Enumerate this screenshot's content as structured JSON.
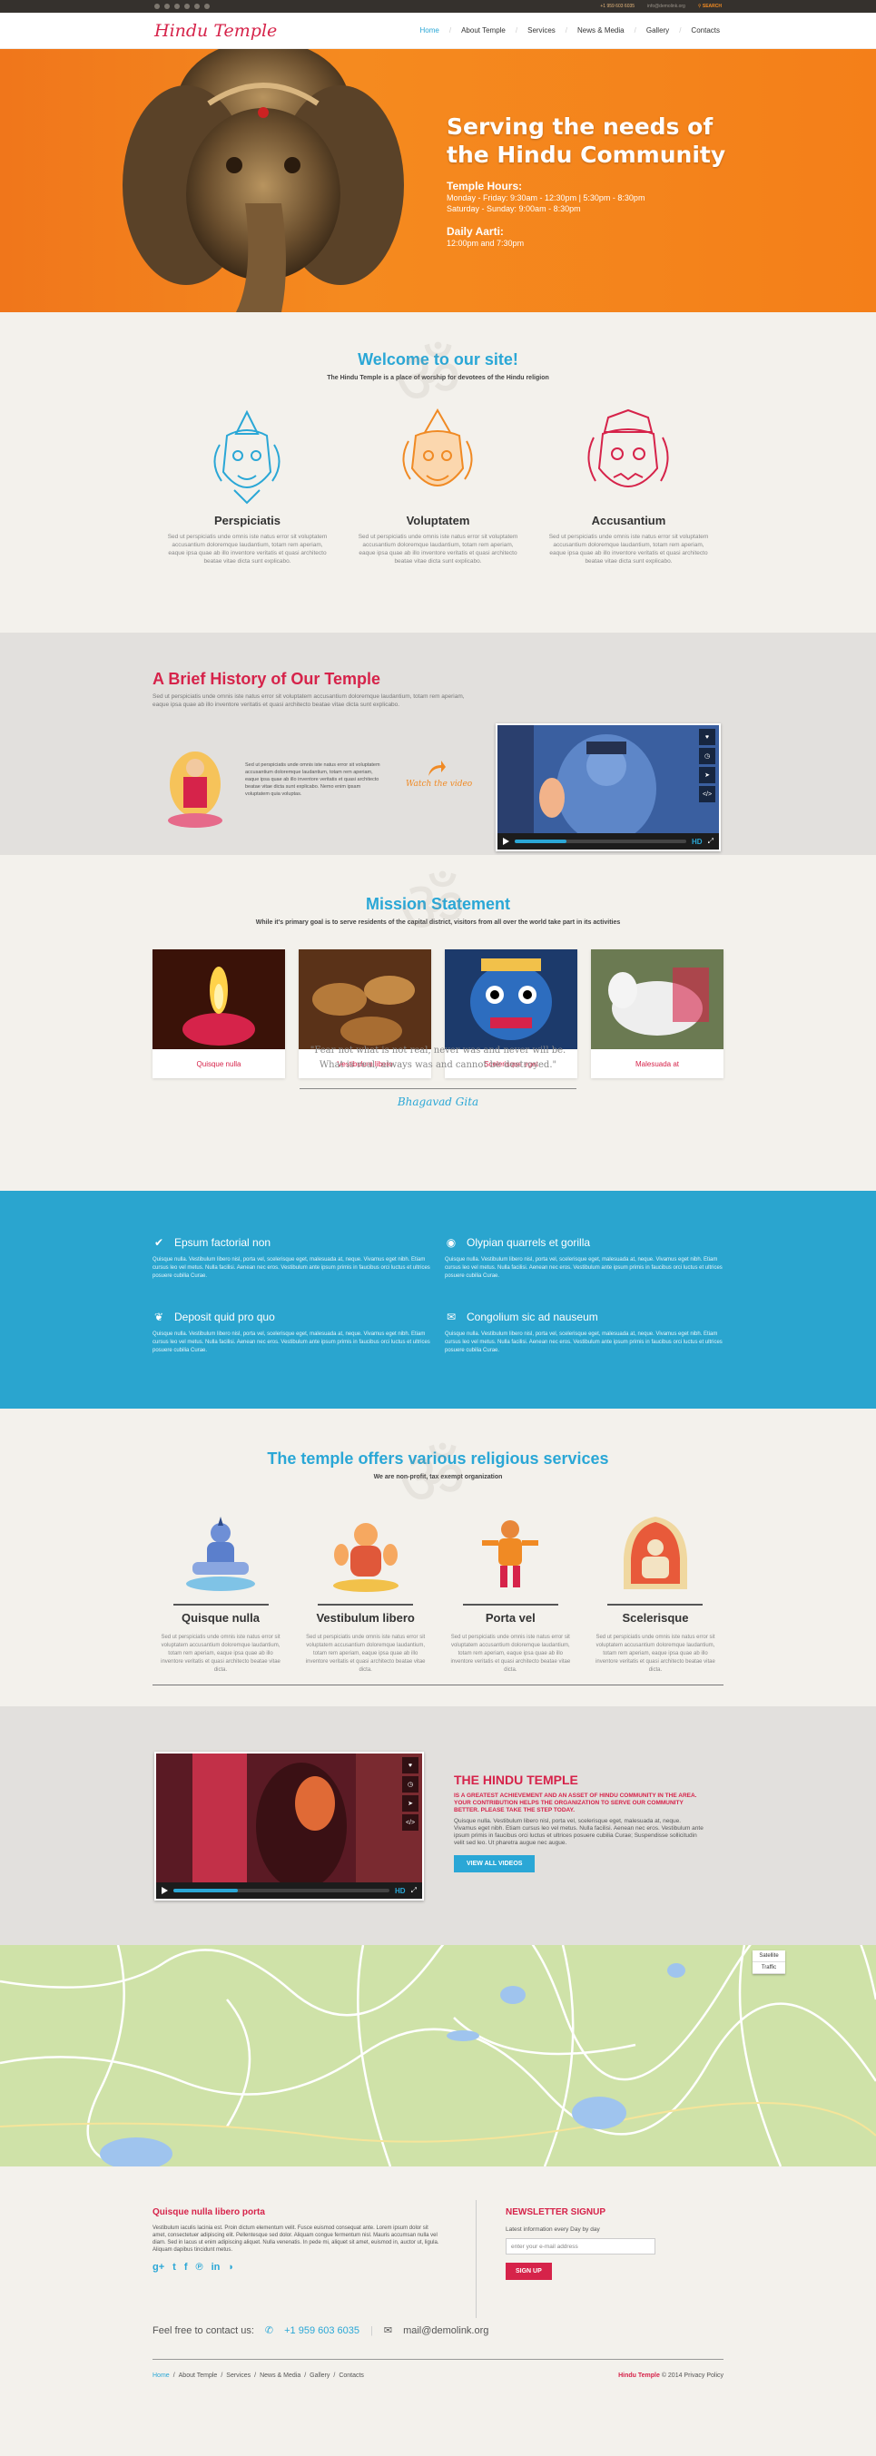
{
  "topbar": {
    "phone": "+1 959 603 6035",
    "email": "info@demolink.org",
    "search": "SEARCH"
  },
  "header": {
    "logo": "Hindu Temple",
    "nav": [
      "Home",
      "About Temple",
      "Services",
      "News & Media",
      "Gallery",
      "Contacts"
    ]
  },
  "hero": {
    "title_line1": "Serving the needs of",
    "title_line2": "the Hindu Community",
    "hours_title": "Temple Hours:",
    "hours_1": "Monday - Friday: 9:30am - 12:30pm | 5:30pm - 8:30pm",
    "hours_2": "Saturday - Sunday: 9:00am - 8:30pm",
    "aarti_title": "Daily Aarti:",
    "aarti_1": "12:00pm and 7:30pm"
  },
  "welcome": {
    "title": "Welcome to our site!",
    "subtitle": "The Hindu Temple is a place of worship for devotees of the Hindu religion",
    "items": [
      {
        "title": "Perspiciatis",
        "text": "Sed ut perspiciatis unde omnis iste natus error sit voluptatem accusantium doloremque laudantium, totam rem aperiam, eaque ipsa quae ab illo inventore veritatis et quasi architecto beatae vitae dicta sunt explicabo."
      },
      {
        "title": "Voluptatem",
        "text": "Sed ut perspiciatis unde omnis iste natus error sit voluptatem accusantium doloremque laudantium, totam rem aperiam, eaque ipsa quae ab illo inventore veritatis et quasi architecto beatae vitae dicta sunt explicabo."
      },
      {
        "title": "Accusantium",
        "text": "Sed ut perspiciatis unde omnis iste natus error sit voluptatem accusantium doloremque laudantium, totam rem aperiam, eaque ipsa quae ab illo inventore veritatis et quasi architecto beatae vitae dicta sunt explicabo."
      }
    ],
    "colors": [
      "#2aa7d6",
      "#f08a24",
      "#d6234a"
    ]
  },
  "history": {
    "title": "A Brief History of Our Temple",
    "intro": "Sed ut perspiciatis unde omnis iste natus error sit voluptatem accusantium doloremque laudantium, totam rem aperiam, eaque ipsa quae ab illo inventore veritatis et quasi architecto beatae vitae dicta sunt explicabo.",
    "small": "Sed ut perspiciatis unde omnis iste natus error sit voluptatem accusantium doloremque laudantium, totam rem aperiam, eaque ipsa quae ab illo inventore veritatis et quasi architecto beatae vitae dicta sunt explicabo. Nemo enim ipsam voluptatem quia voluptas.",
    "watch": "Watch the video",
    "video_hd": "HD"
  },
  "mission": {
    "title": "Mission Statement",
    "subtitle": "While it's primary goal is to serve residents of the capital district, visitors from all over the world take part in its activities",
    "cards": [
      "Quisque nulla",
      "Vestibulum libero",
      "Scelerisque eget",
      "Malesuada at"
    ],
    "quote1": "\"Fear not what is not real, never was and never will be.",
    "quote2": "What is real, always was and cannot be destroyed.\"",
    "sign": "Bhagavad Gita"
  },
  "features": [
    {
      "title": "Epsum factorial non",
      "icon": "check-icon",
      "text": "Quisque nulla. Vestibulum libero nisl, porta vel, scelerisque eget, malesuada at, neque. Vivamus eget nibh. Etiam cursus leo vel metus. Nulla facilisi. Aenean nec eros. Vestibulum ante ipsum primis in faucibus orci luctus et ultrices posuere cubilia Curae."
    },
    {
      "title": "Olypian quarrels et gorilla",
      "icon": "globe-icon",
      "text": "Quisque nulla. Vestibulum libero nisl, porta vel, scelerisque eget, malesuada at, neque. Vivamus eget nibh. Etiam cursus leo vel metus. Nulla facilisi. Aenean nec eros. Vestibulum ante ipsum primis in faucibus orci luctus et ultrices posuere cubilia Curae."
    },
    {
      "title": "Deposit quid pro quo",
      "icon": "leaf-icon",
      "text": "Quisque nulla. Vestibulum libero nisl, porta vel, scelerisque eget, malesuada at, neque. Vivamus eget nibh. Etiam cursus leo vel metus. Nulla facilisi. Aenean nec eros. Vestibulum ante ipsum primis in faucibus orci luctus et ultrices posuere cubilia Curae."
    },
    {
      "title": "Congolium sic ad nauseum",
      "icon": "chat-icon",
      "text": "Quisque nulla. Vestibulum libero nisl, porta vel, scelerisque eget, malesuada at, neque. Vivamus eget nibh. Etiam cursus leo vel metus. Nulla facilisi. Aenean nec eros. Vestibulum ante ipsum primis in faucibus orci luctus et ultrices posuere cubilia Curae."
    }
  ],
  "services": {
    "title": "The temple offers various religious services",
    "subtitle": "We are non-profit, tax exempt organization",
    "items": [
      {
        "title": "Quisque nulla",
        "text": "Sed ut perspiciatis unde omnis iste natus error sit voluptatem accusantium doloremque laudantium, totam rem aperiam, eaque ipsa quae ab illo inventore veritatis et quasi architecto beatae vitae dicta."
      },
      {
        "title": "Vestibulum libero",
        "text": "Sed ut perspiciatis unde omnis iste natus error sit voluptatem accusantium doloremque laudantium, totam rem aperiam, eaque ipsa quae ab illo inventore veritatis et quasi architecto beatae vitae dicta."
      },
      {
        "title": "Porta vel",
        "text": "Sed ut perspiciatis unde omnis iste natus error sit voluptatem accusantium doloremque laudantium, totam rem aperiam, eaque ipsa quae ab illo inventore veritatis et quasi architecto beatae vitae dicta."
      },
      {
        "title": "Scelerisque",
        "text": "Sed ut perspiciatis unde omnis iste natus error sit voluptatem accusantium doloremque laudantium, totam rem aperiam, eaque ipsa quae ab illo inventore veritatis et quasi architecto beatae vitae dicta."
      }
    ]
  },
  "temple": {
    "title": "THE HINDU TEMPLE",
    "red": "IS A GREATEST ACHIEVEMENT AND AN ASSET OF HINDU COMMUNITY IN THE AREA. YOUR CONTRIBUTION HELPS THE ORGANIZATION TO SERVE OUR COMMUNITY BETTER. PLEASE TAKE THE STEP TODAY.",
    "text": "Quisque nulla. Vestibulum libero nisl, porta vel, scelerisque eget, malesuada at, neque. Vivamus eget nibh. Etiam cursus leo vel metus. Nulla facilisi. Aenean nec eros. Vestibulum ante ipsum primis in faucibus orci luctus et ultrices posuere cubilia Curae; Suspendisse sollicitudin velit sed leo. Ut pharetra augue nec augue.",
    "button": "VIEW ALL VIDEOS"
  },
  "map": {
    "satellite": "Satellite",
    "traffic": "Traffic"
  },
  "footer": {
    "col1_title": "Quisque nulla libero porta",
    "col1_text": "Vestibulum iaculis lacinia est. Proin dictum elementum velit. Fusce euismod consequat ante. Lorem ipsum dolor sit amet, consectetuer adipiscing elit. Pellentesque sed dolor. Aliquam congue fermentum nisl. Mauris accumsan nulla vel diam. Sed in lacus ut enim adipiscing aliquet. Nulla venenatis. In pede mi, aliquet sit amet, euismod in, auctor ut, ligula. Aliquam dapibus tincidunt metus.",
    "col2_title": "NEWSLETTER SIGNUP",
    "col2_text": "Latest information every Day by day",
    "email_placeholder": "enter your e-mail address",
    "signup": "SIGN UP",
    "feel_free": "Feel free to contact us:",
    "phone": "+1 959 603 6035",
    "email": "mail@demolink.org",
    "bottom_nav": [
      "Home",
      "About Temple",
      "Services",
      "News & Media",
      "Gallery",
      "Contacts"
    ],
    "copy_brand": "Hindu Temple",
    "copy_text": "© 2014 Privacy Policy"
  }
}
